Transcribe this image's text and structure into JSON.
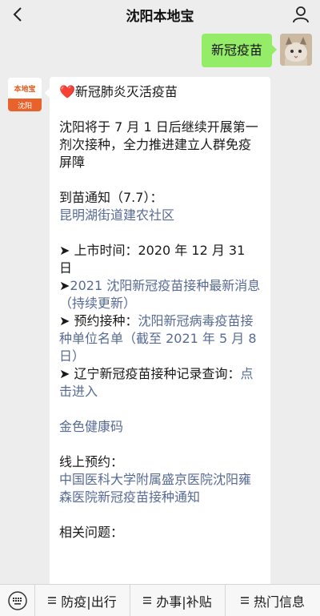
{
  "header": {
    "title": "沈阳本地宝"
  },
  "outgoing": {
    "text": "新冠疫苗"
  },
  "bot": {
    "avatar_top": "本地宝",
    "avatar_bottom": "沈阳"
  },
  "message": {
    "heading_icon": "❤️",
    "heading": "新冠肺炎灭活疫苗",
    "intro": "沈阳将于 7 月 1 日后继续开展第一剂次接种，全力推进建立人群免疫屏障",
    "notice_label": "到苗通知（7.7）：",
    "notice_link": "昆明湖街道建农社区",
    "launch_label": "➤ 上市时间：2020 年 12 月 31 日",
    "item2_prefix": "➤",
    "item2_link": "2021 沈阳新冠疫苗接种最新消息（持续更新）",
    "item3_prefix": "➤ 预约接种：",
    "item3_link": "沈阳新冠病毒疫苗接种单位名单（截至 2021 年 5 月 8 日）",
    "item4_prefix": "➤ 辽宁新冠疫苗接种记录查询：",
    "item4_link": "点击进入",
    "health_code_link": "金色健康码",
    "online_label": "线上预约：",
    "online_link": "中国医科大学附属盛京医院沈阳雍森医院新冠疫苗接种通知",
    "related_label": "相关问题："
  },
  "menu": {
    "items": [
      "防疫|出行",
      "办事|补贴",
      "热门信息"
    ]
  },
  "colors": {
    "outgoing_bubble": "#95ec69",
    "link": "#576b95",
    "background": "#ededed"
  }
}
